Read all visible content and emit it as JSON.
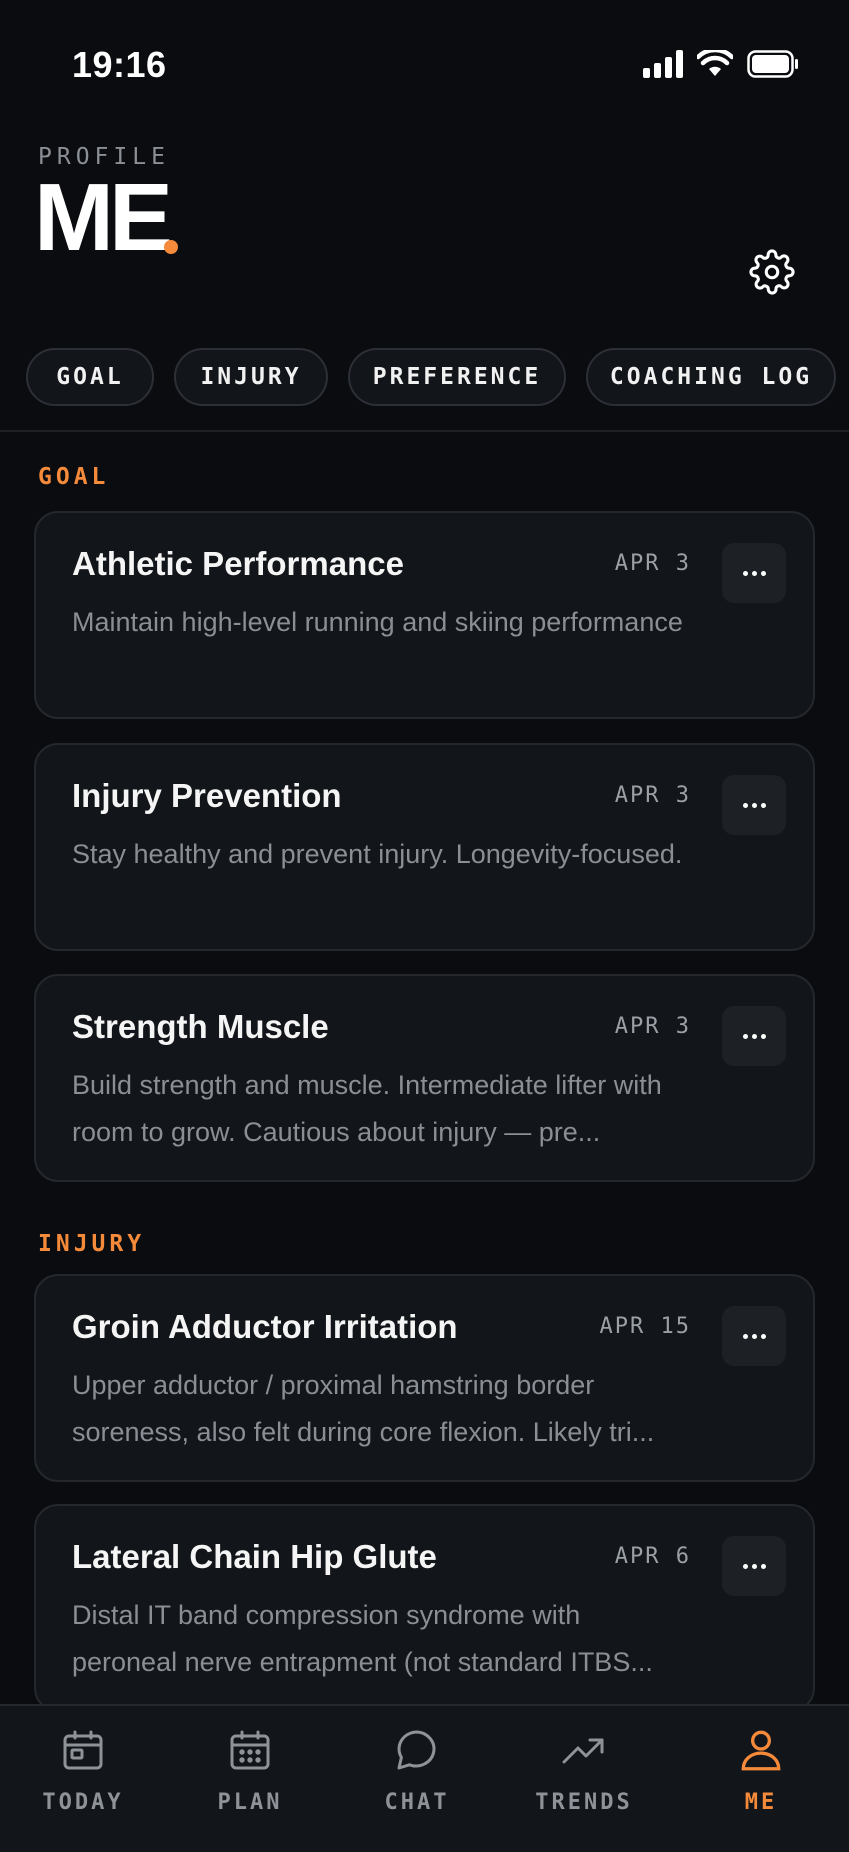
{
  "status_bar": {
    "time": "19:16"
  },
  "header": {
    "eyebrow": "PROFILE",
    "title": "ME"
  },
  "chips": [
    {
      "label": "GOAL"
    },
    {
      "label": "INJURY"
    },
    {
      "label": "PREFERENCE"
    },
    {
      "label": "COACHING LOG"
    }
  ],
  "sections": {
    "goal": {
      "label": "GOAL",
      "cards": [
        {
          "title": "Athletic Performance",
          "date": "APR 3",
          "desc": "Maintain high-level running and skiing performance"
        },
        {
          "title": "Injury Prevention",
          "date": "APR 3",
          "desc": "Stay healthy and prevent injury. Longevity-focused."
        },
        {
          "title": "Strength Muscle",
          "date": "APR 3",
          "desc": "Build strength and muscle. Intermediate lifter with room to grow. Cautious about injury — pre..."
        }
      ]
    },
    "injury": {
      "label": "INJURY",
      "cards": [
        {
          "title": "Groin Adductor Irritation",
          "date": "APR 15",
          "desc": "Upper adductor / proximal hamstring border soreness, also felt during core flexion. Likely tri..."
        },
        {
          "title": "Lateral Chain Hip Glute",
          "date": "APR 6",
          "desc": "Distal IT band compression syndrome with peroneal nerve entrapment (not standard ITBS..."
        }
      ]
    }
  },
  "nav": [
    {
      "label": "TODAY",
      "icon": "today-icon"
    },
    {
      "label": "PLAN",
      "icon": "calendar-icon"
    },
    {
      "label": "CHAT",
      "icon": "chat-icon"
    },
    {
      "label": "TRENDS",
      "icon": "trends-icon"
    },
    {
      "label": "ME",
      "icon": "profile-icon"
    }
  ],
  "colors": {
    "accent": "#f58a3a",
    "background": "#0a0c0f",
    "card": "#121519"
  }
}
